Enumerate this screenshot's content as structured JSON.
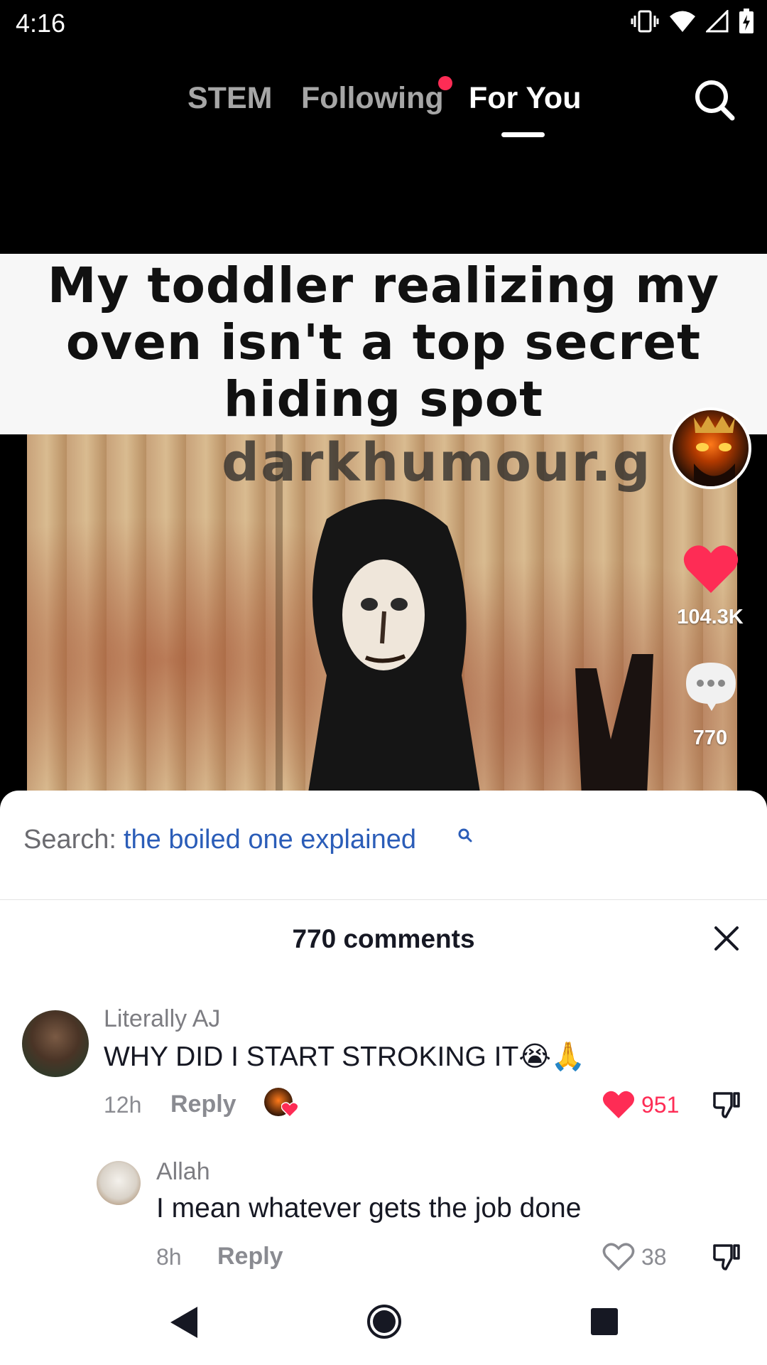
{
  "status_bar": {
    "time": "4:16"
  },
  "top_nav": {
    "tabs": [
      {
        "label": "STEM"
      },
      {
        "label": "Following"
      },
      {
        "label": "For You"
      }
    ],
    "search_icon": "search-icon"
  },
  "video": {
    "caption_lines": [
      "My toddler realizing my",
      "oven isn't a top secret",
      "hiding spot"
    ],
    "watermark": "darkhumour.g"
  },
  "actions": {
    "like_count": "104.3K",
    "comment_count": "770"
  },
  "comments_sheet": {
    "search_label": "Search:",
    "search_term": "the boiled one explained",
    "title": "770 comments",
    "comments": [
      {
        "username": "Literally AJ",
        "text": "WHY DID I START STROKING IT😭🙏",
        "time": "12h",
        "reply_label": "Reply",
        "likes": "951",
        "liked": true
      },
      {
        "username": "Allah",
        "text": "I mean whatever gets the job done",
        "time": "8h",
        "reply_label": "Reply",
        "likes": "38",
        "liked": false
      }
    ]
  },
  "colors": {
    "accent_red": "#fe2c55",
    "link_blue": "#2b5db8"
  }
}
